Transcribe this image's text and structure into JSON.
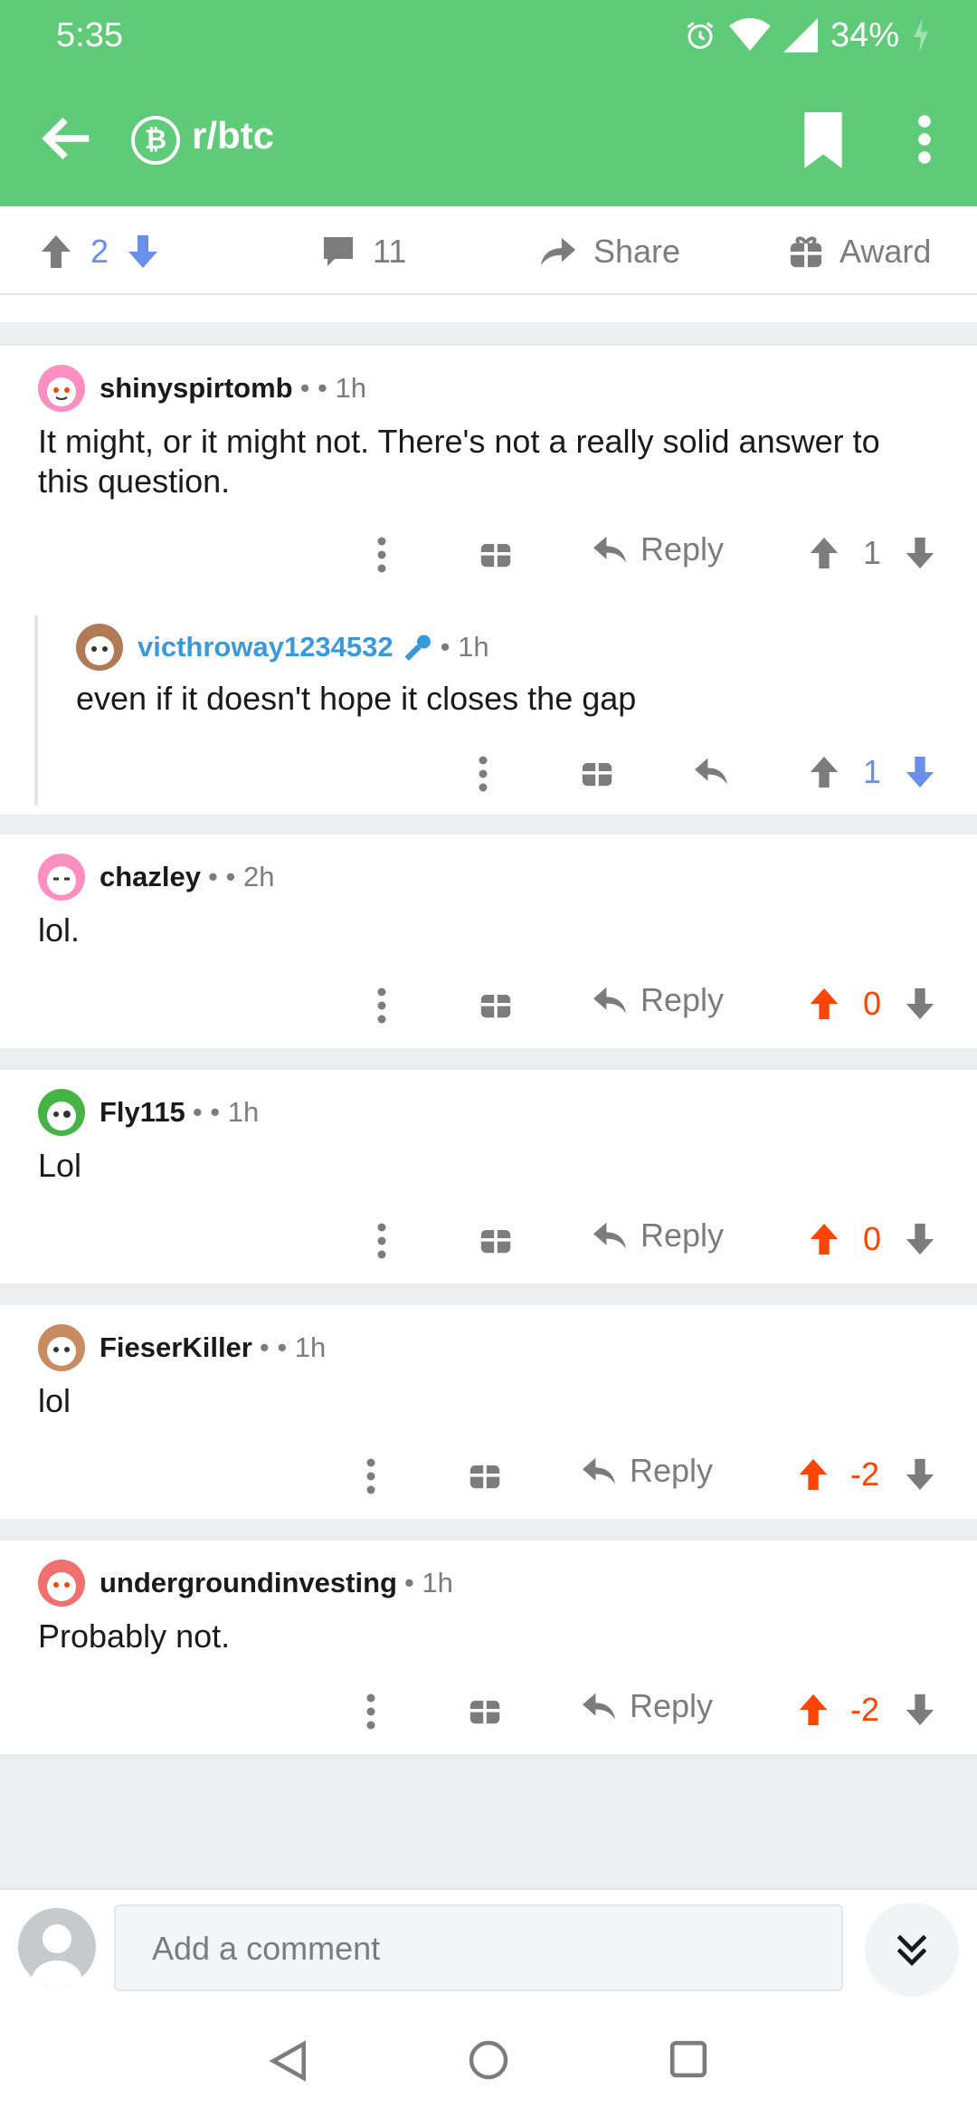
{
  "status": {
    "time": "5:35",
    "battery": "34%"
  },
  "header": {
    "subreddit": "r/btc",
    "sub_icon_glyph": "₿"
  },
  "post_actions": {
    "score": "2",
    "comments": "11",
    "share": "Share",
    "award": "Award"
  },
  "comments": [
    {
      "user": "shinyspirtomb",
      "meta": "•  • 1h",
      "text": "It might, or it might not. There's not a really solid answer to this question.",
      "reply": "Reply",
      "score": "1"
    },
    {
      "user": "victhroway1234532",
      "meta": "• 1h",
      "text": "even if it doesn't hope it closes the gap",
      "score": "1"
    },
    {
      "user": "chazley",
      "meta": "•  • 2h",
      "text": "lol.",
      "reply": "Reply",
      "score": "0"
    },
    {
      "user": "Fly115",
      "meta": "•  • 1h",
      "text": "Lol",
      "reply": "Reply",
      "score": "0"
    },
    {
      "user": "FieserKiller",
      "meta": "•  • 1h",
      "text": "lol",
      "reply": "Reply",
      "score": "-2"
    },
    {
      "user": "undergroundinvesting",
      "meta": "• 1h",
      "text": "Probably not.",
      "reply": "Reply",
      "score": "-2"
    }
  ],
  "composer": {
    "placeholder": "Add a comment"
  },
  "colors": {
    "appbar": "#5fca78",
    "upvote_active": "#ff4500",
    "downvote_active": "#6a8fe8",
    "op_link": "#3a9ad9"
  }
}
